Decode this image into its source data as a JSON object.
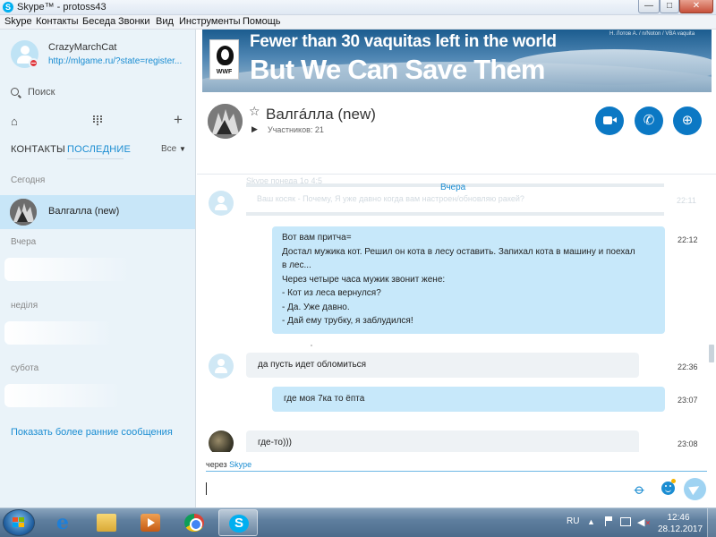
{
  "window": {
    "title": "Skype™ - protoss43",
    "controls": {
      "minimize": "—",
      "maximize": "□",
      "close": "✕"
    }
  },
  "menu": {
    "items": [
      "Skype",
      "Контакты",
      "Беседа",
      "Звонки",
      "Вид",
      "Инструменты",
      "Помощь"
    ]
  },
  "sidebar": {
    "profile": {
      "name": "CrazyMarchCat",
      "mood": "http://mlgame.ru/?state=register...",
      "status_color": "#e0383e"
    },
    "search_label": "Поиск",
    "tabs": {
      "contacts": "КОНТАКТЫ",
      "recent": "ПОСЛЕДНИЕ"
    },
    "filter_label": "Все",
    "sections": {
      "today": "Сегодня",
      "yesterday": "Вчера",
      "week": "неділя",
      "saturday": "субота"
    },
    "recent_item_name": "Валгалла (new)",
    "show_earlier": "Показать более ранние сообщения"
  },
  "banner": {
    "line1": "Fewer than 30 vaquitas left in the world",
    "line2": "But We Can Save Them",
    "logo_text": "WWF",
    "credit": "Н. Лотов А. / n/Noton / VBA vaquita"
  },
  "chat": {
    "title": "Валгáлла (new)",
    "participants": "Участников: 21",
    "day_label": "Вчера",
    "ghost_top": "Skype   понеда 1о 4:5",
    "ghost_line": "Ваш косяк - Почему, Я уже давно когда вам настроен/обновляю ракей?",
    "ghost_time": "22:11",
    "messages": [
      {
        "lines": [
          "Вот вам притча=",
          "Достал мужика кот. Решил он кота в лесу оставить. Запихал кота в машину и поехал",
          "в лес...",
          "Через четыре часа мужик звонит жене:",
          "- Кот из леса вернулся?",
          "- Да. Уже давно.",
          "- Дай ему трубку, я заблудился!"
        ],
        "time": "22:12"
      },
      {
        "text": "да пусть идет обломиться",
        "time": "22:36"
      },
      {
        "text": "где моя 7ка то ёпта",
        "time": "23:07"
      },
      {
        "text": "где-то)))",
        "time": "23:08"
      }
    ]
  },
  "compose": {
    "via_prefix": "через",
    "via_link": "Skype"
  },
  "taskbar": {
    "apps": [
      "start",
      "internet-explorer",
      "explorer",
      "media-player",
      "chrome",
      "skype"
    ],
    "language": "RU",
    "time": "12:46",
    "date": "28.12.2017"
  },
  "colors": {
    "accent": "#1b8dd2",
    "call_button": "#0b78c4",
    "outgoing_bubble": "#c7e8fa",
    "incoming_bubble": "#eef2f5",
    "selected_item": "#c8e6f8"
  }
}
